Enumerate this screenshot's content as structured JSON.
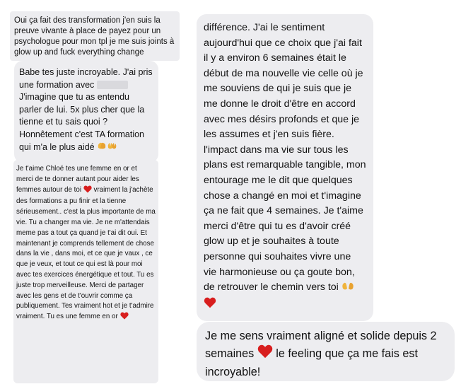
{
  "messages": {
    "m1": {
      "text": "Oui ça fait des transformation j'en suis la preuve vivante à place de payez pour un psychologue pour mon tpl je me suis joints à glow up and fuck everything change"
    },
    "m2": {
      "part1": "Babe tes juste incroyable. J'ai pris une formation avec",
      "part2": "J'imagine que tu as entendu parler de lui. 5x plus cher que la tienne et tu sais quoi ? Honnêtement c'est TA formation qui m'a le plus aidé"
    },
    "m3": {
      "part1": "Je t'aime Chloé tes une femme en or et merci de te donner autant pour aider les femmes autour de toi",
      "part2": "vraiment la j'achète des formations a pu finir et la tienne sérieusement.. c'est la plus importante de ma vie. Tu a changer ma vie. Je ne m'attendais meme pas a tout ça quand je t'ai dit oui. Et maintenant je comprends tellement de chose dans la vie , dans moi, et ce que je vaux , ce que je veux, et tout ce qui est là pour moi avec tes exercices énergétique et tout. Tu es juste trop merveilleuse. Merci de partager avec les gens et de t'ouvrir comme ça publiquement. Tes vraiment hot et je t'admire vraiment. Tu es une femme en or"
    },
    "m4": {
      "text": "différence. J'ai le sentiment aujourd'hui que ce choix que j'ai fait il y a environ 6 semaines était le début de ma nouvelle vie celle où je me souviens de qui je suis que je me donne le droit d'être en accord avec mes désirs profonds et que je les assumes et j'en suis fière. l'impact dans ma vie sur tous les plans est remarquable tangible, mon entourage me le dit que quelques chose a changé en moi et t'imagine ça ne fait que 4 semaines. Je t'aime merci d'être qui tu es d'avoir créé glow up et je souhaites à toute personne qui souhaites vivre  une vie harmonieuse ou ça goute bon, de retrouver le chemin vers toi"
    },
    "m5": {
      "part1": "Je me sens vraiment aligné et solide depuis 2 semaines",
      "part2": "le feeling que ça me fais est incroyable!"
    }
  }
}
